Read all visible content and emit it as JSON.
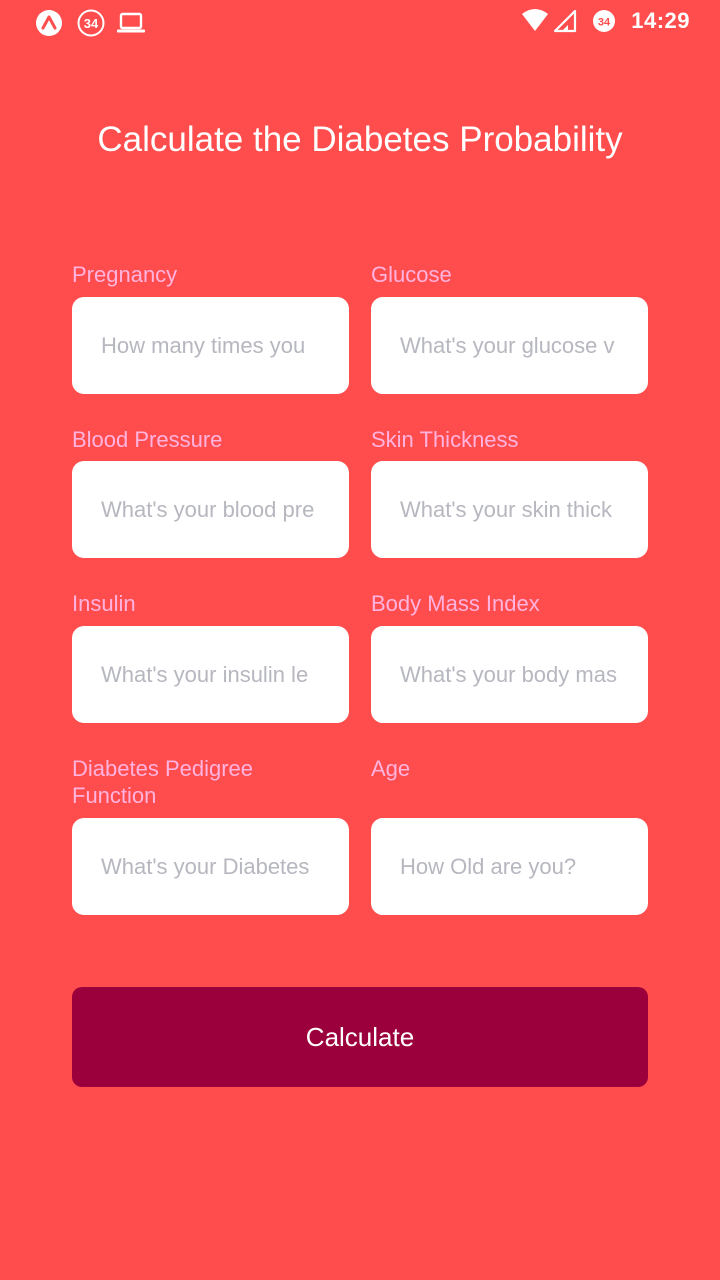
{
  "status_bar": {
    "time": "14:29",
    "notification_badge": "34",
    "right_badge": "34",
    "icons": [
      "app-logo-icon",
      "notification-badge-icon",
      "laptop-icon",
      "wifi-icon",
      "signal-icon",
      "battery-saver-icon"
    ]
  },
  "page": {
    "title": "Calculate the Diabetes Probability"
  },
  "form": {
    "fields": [
      {
        "label": "Pregnancy",
        "placeholder": "How many times you",
        "value": ""
      },
      {
        "label": "Glucose",
        "placeholder": "What's your glucose v",
        "value": ""
      },
      {
        "label": "Blood Pressure",
        "placeholder": "What's your blood pre",
        "value": ""
      },
      {
        "label": "Skin Thickness",
        "placeholder": "What's your skin thick",
        "value": ""
      },
      {
        "label": "Insulin",
        "placeholder": "What's your insulin le",
        "value": ""
      },
      {
        "label": "Body Mass Index",
        "placeholder": "What's your body mas",
        "value": ""
      },
      {
        "label": "Diabetes Pedigree Function",
        "placeholder": "What's your Diabetes",
        "value": ""
      },
      {
        "label": "Age",
        "placeholder": "How Old are you?",
        "value": ""
      }
    ],
    "submit_label": "Calculate"
  },
  "colors": {
    "background": "#FF4D4D",
    "label": "#FFB3DE",
    "button": "#9B003D",
    "placeholder": "#B6B7BF"
  }
}
